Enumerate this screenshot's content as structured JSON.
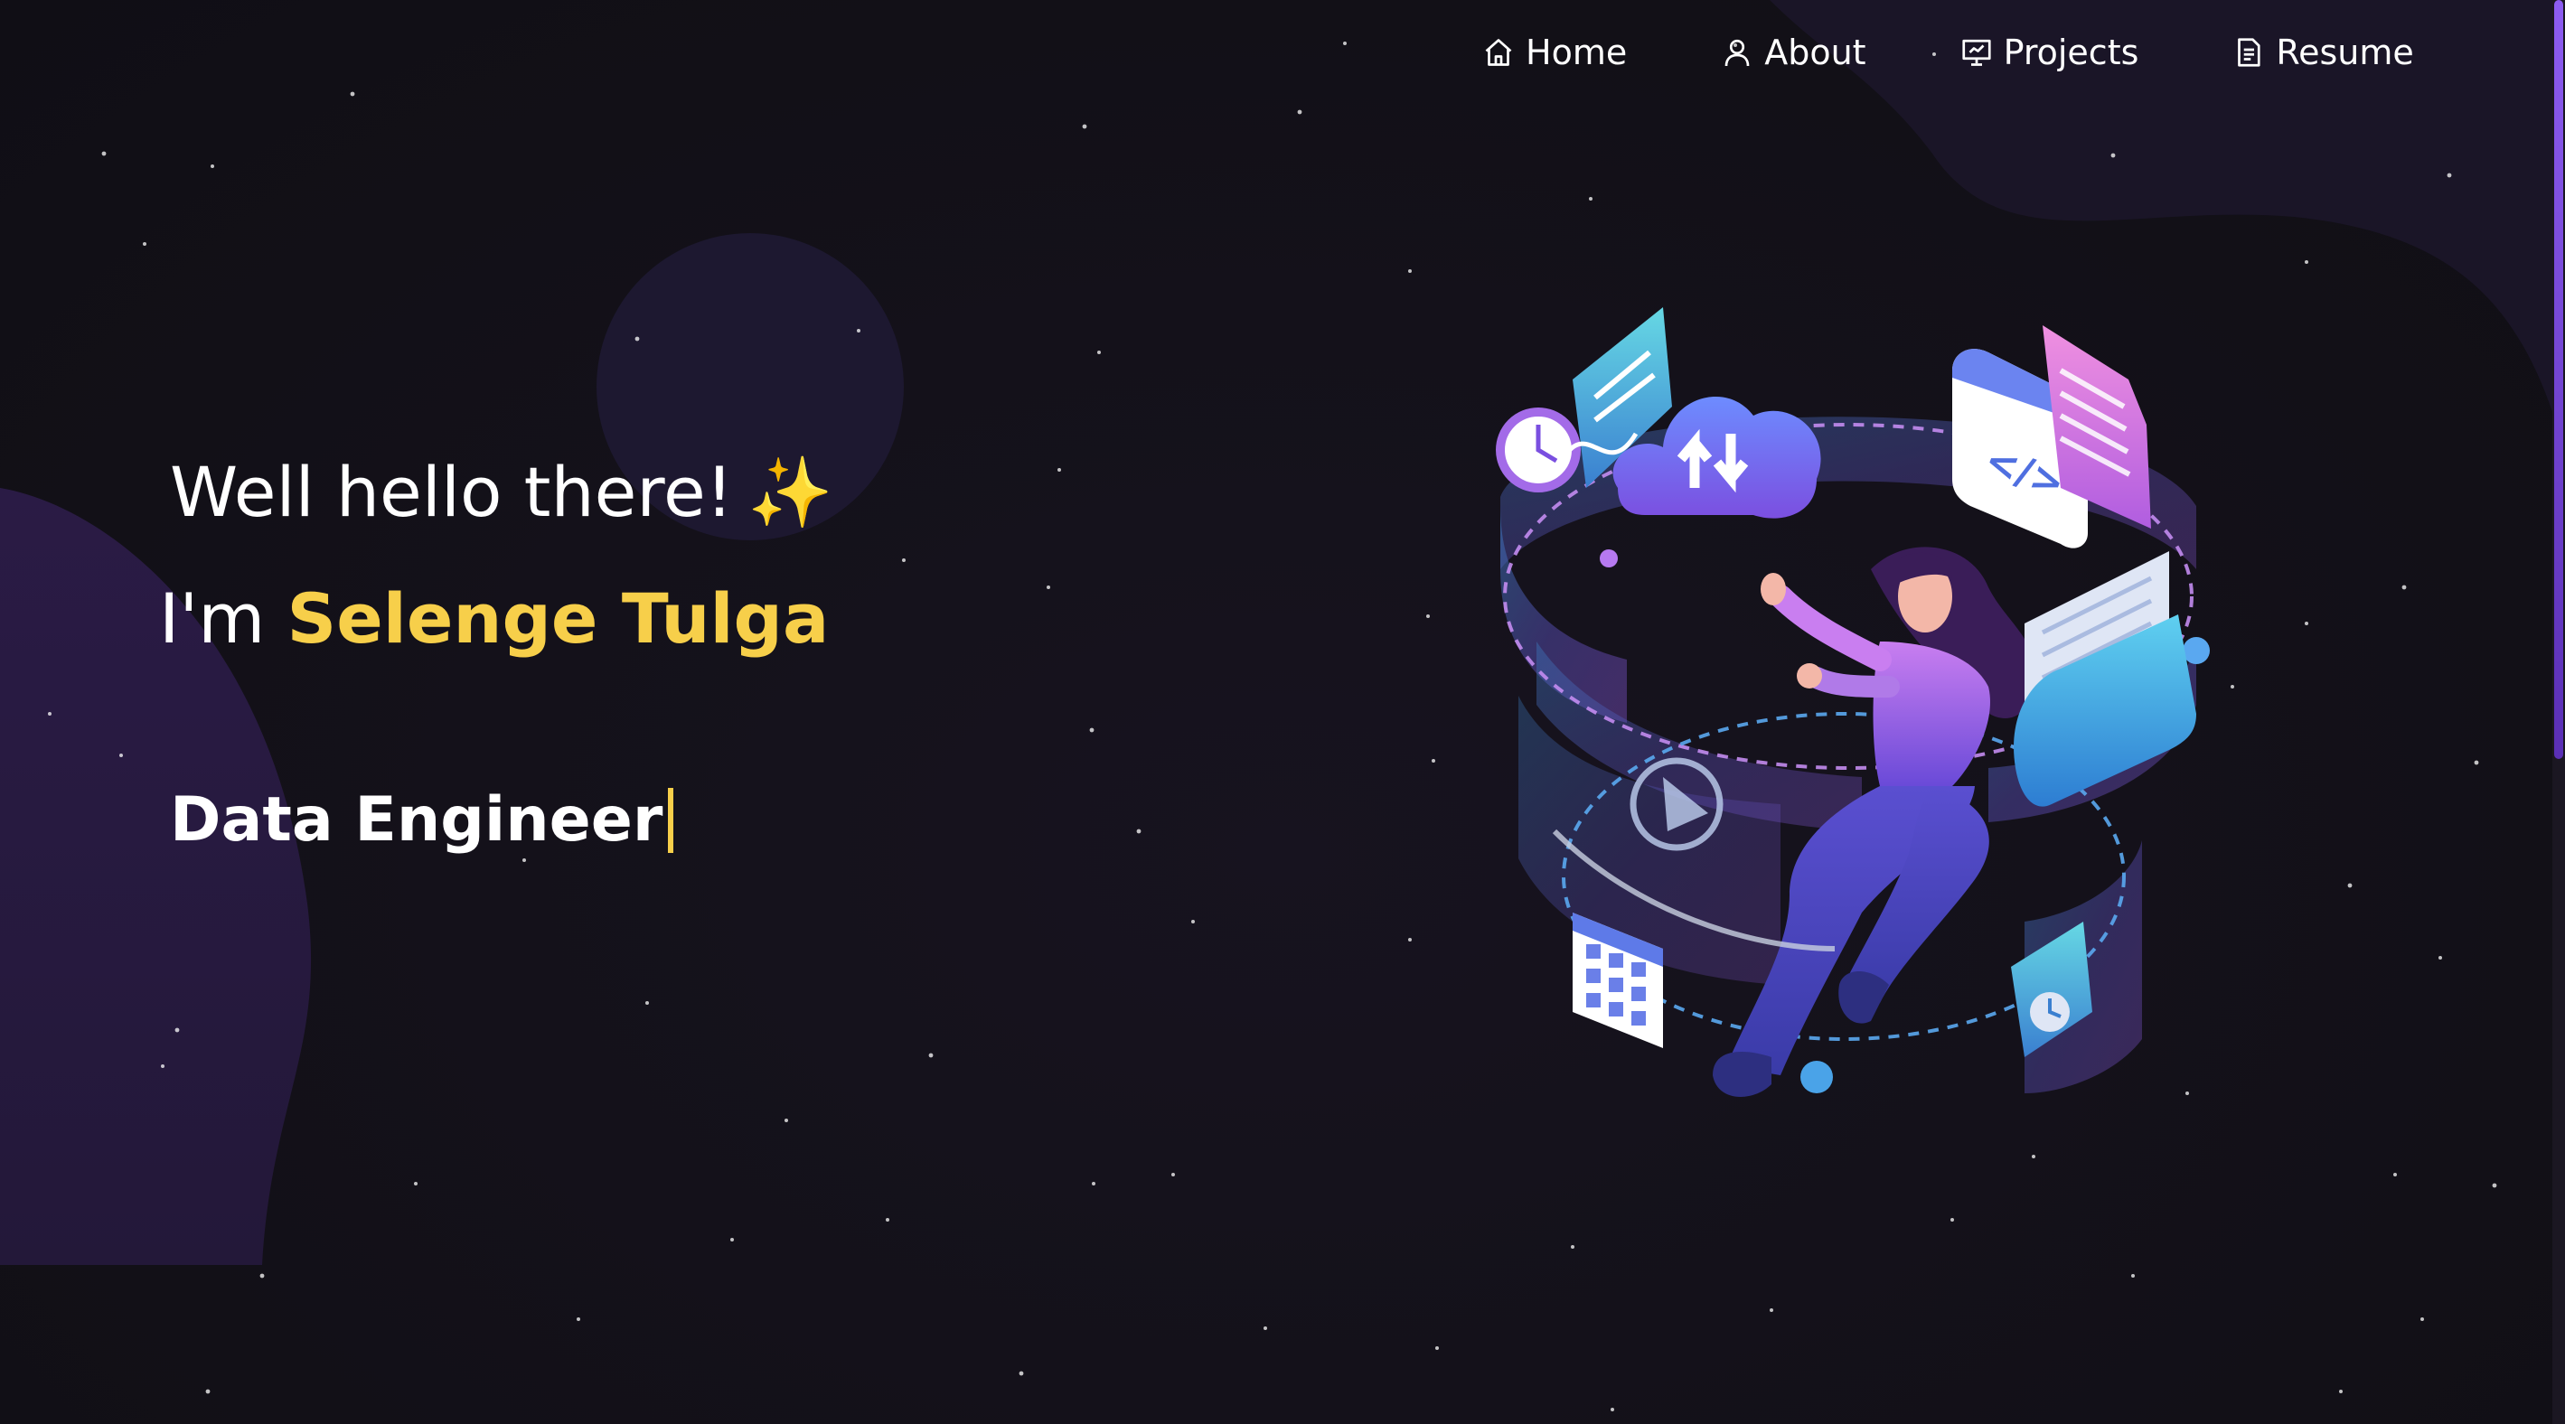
{
  "nav": {
    "items": [
      {
        "label": "Home",
        "icon": "home-icon"
      },
      {
        "label": "About",
        "icon": "user-icon"
      },
      {
        "label": "Projects",
        "icon": "presentation-icon"
      },
      {
        "label": "Resume",
        "icon": "document-icon"
      }
    ]
  },
  "hero": {
    "greeting": "Well hello there!",
    "sparkle": "✨",
    "intro_prefix": "I'm ",
    "name": "Selenge Tulga",
    "role": "Data Engineer"
  },
  "colors": {
    "background": "#131018",
    "accent": "#f7cf4a",
    "purple": "#8d5cf0"
  }
}
